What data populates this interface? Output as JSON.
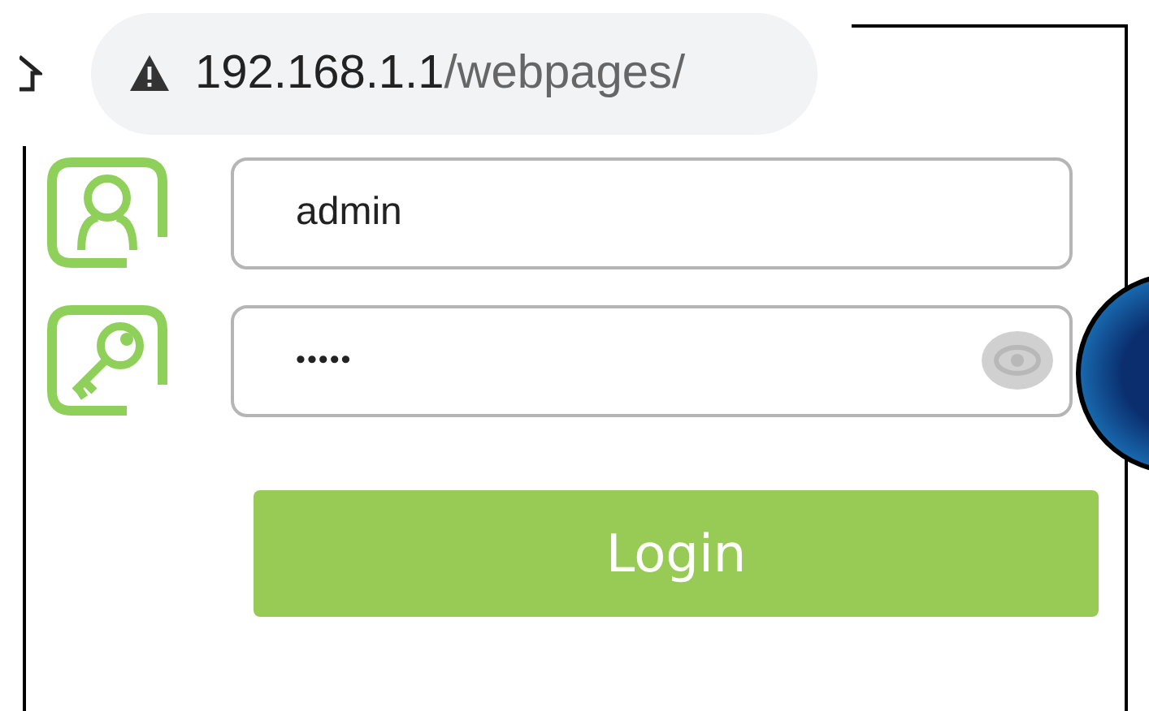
{
  "address_bar": {
    "host": "192.168.1.1",
    "path": "/webpages/"
  },
  "login_form": {
    "username": {
      "value": "admin"
    },
    "password": {
      "value": "•••••"
    },
    "button": "Login"
  }
}
